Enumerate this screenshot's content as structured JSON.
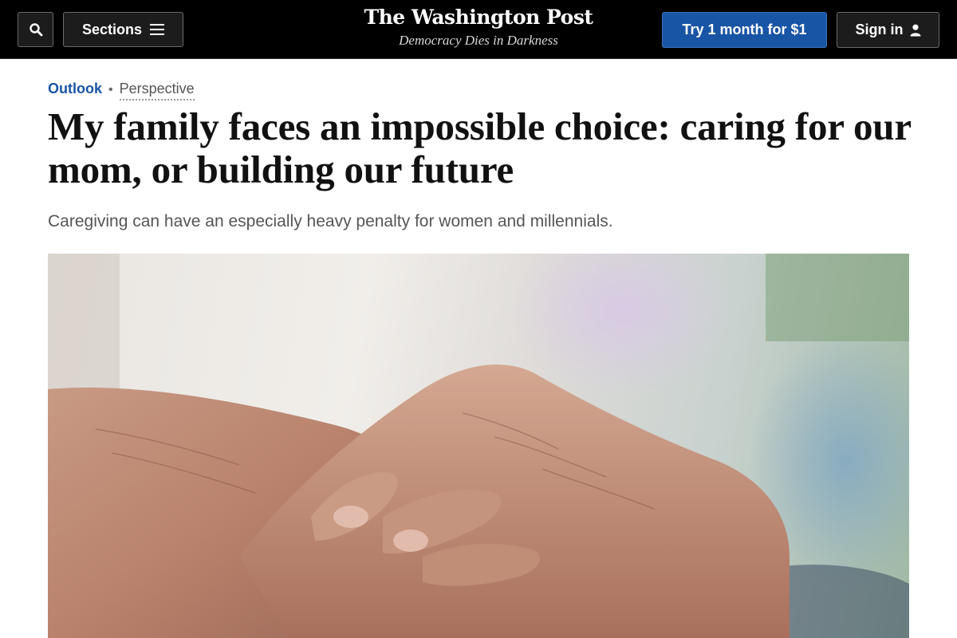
{
  "header": {
    "search_icon": "search-icon",
    "sections_label": "Sections",
    "menu_icon": "hamburger-icon",
    "logo": "The Washington Post",
    "tagline": "Democracy Dies in Darkness",
    "subscribe_label": "Try 1 month for $1",
    "signin_label": "Sign in",
    "user_icon": "user-icon",
    "colors": {
      "bar": "#000000",
      "subscribe": "#1955a5"
    }
  },
  "article": {
    "section": "Outlook",
    "label": "Perspective",
    "headline": "My family faces an impossible choice: caring for our mom, or building our future",
    "subheadline": "Caregiving can have an especially heavy penalty for women and millennials."
  },
  "colors": {
    "section_link": "#1955a5"
  }
}
